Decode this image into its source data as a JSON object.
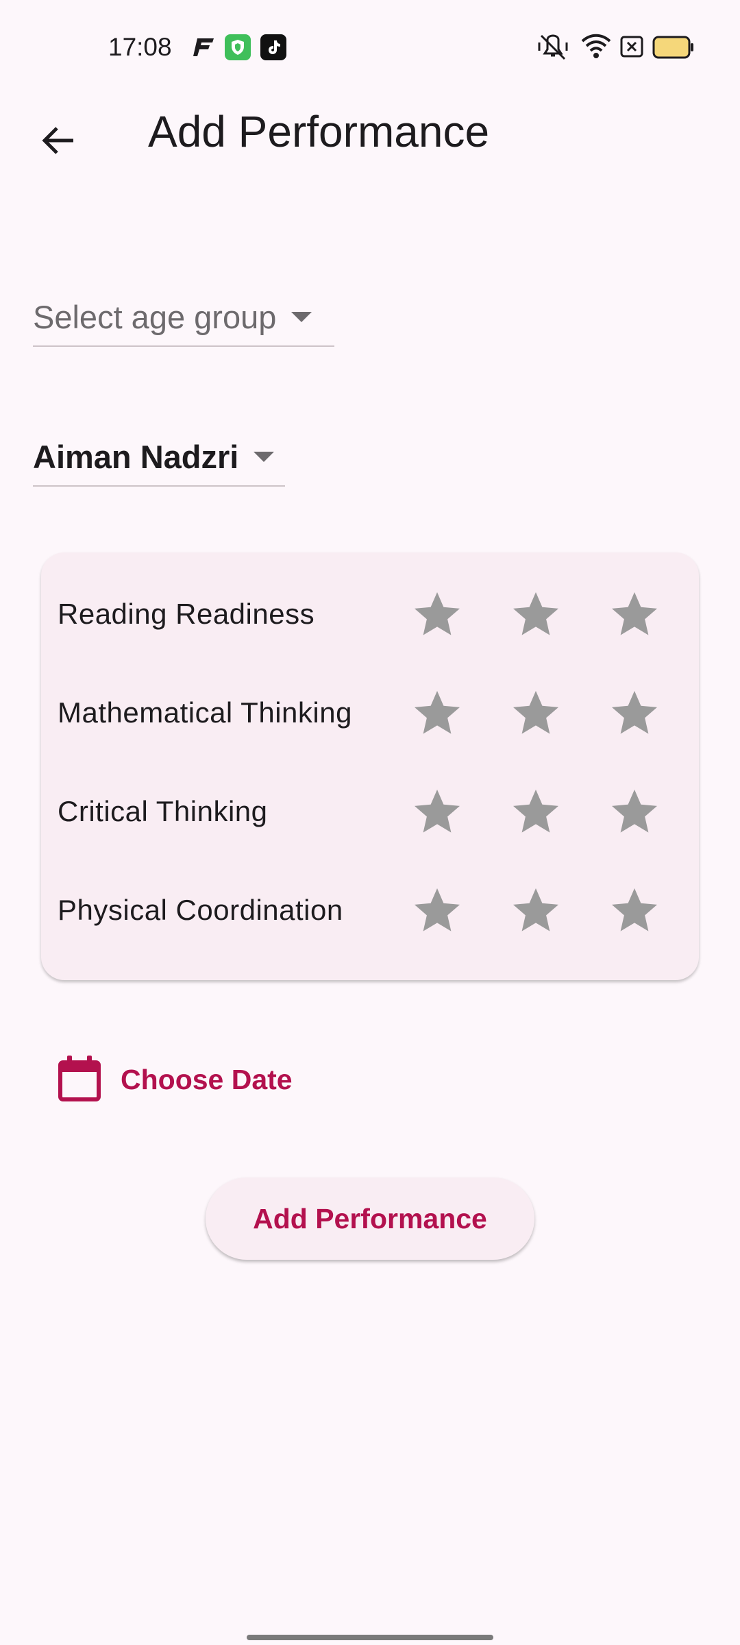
{
  "status_bar": {
    "time": "17:08",
    "left_icons": [
      "flipboard-icon",
      "shield-app-icon",
      "tiktok-icon"
    ],
    "right_icons": [
      "vibrate-off-icon",
      "wifi-icon",
      "sim-x-icon",
      "battery-icon"
    ],
    "battery_color": "#f5d77a"
  },
  "app_bar": {
    "title": "Add Performance",
    "back_icon": "arrow-back-icon"
  },
  "form": {
    "age_group_placeholder": "Select age group",
    "student_selected": "Aiman Nadzri"
  },
  "ratings": {
    "stars_per_row": 3,
    "star_color": "#9a9a9a",
    "rows": [
      {
        "label": "Reading Readiness",
        "rating": 0
      },
      {
        "label": "Mathematical Thinking",
        "rating": 0
      },
      {
        "label": "Critical Thinking",
        "rating": 0
      },
      {
        "label": "Physical Coordination",
        "rating": 0
      }
    ]
  },
  "choose_date": {
    "label": "Choose Date",
    "icon": "calendar-icon"
  },
  "submit": {
    "label": "Add Performance"
  },
  "colors": {
    "accent": "#b3114e",
    "background": "#fdf7fb",
    "card": "#f9edf3"
  }
}
